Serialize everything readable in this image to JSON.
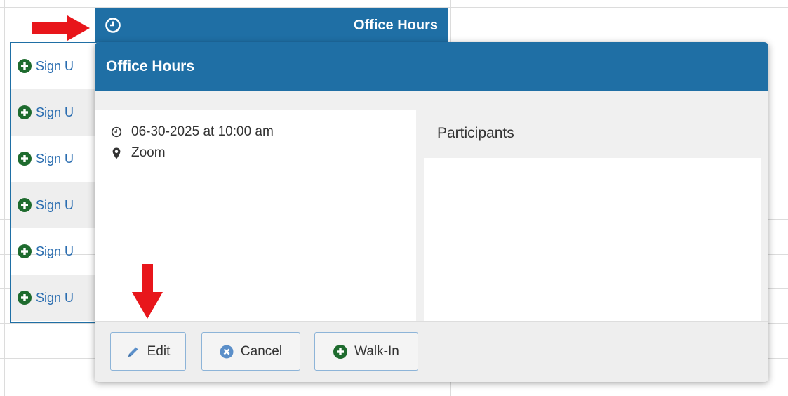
{
  "event": {
    "title": "Office Hours"
  },
  "slots": {
    "items": [
      {
        "label": "Sign U"
      },
      {
        "label": "Sign U"
      },
      {
        "label": "Sign U"
      },
      {
        "label": "Sign U"
      },
      {
        "label": "Sign U"
      },
      {
        "label": "Sign U"
      }
    ]
  },
  "popup": {
    "title": "Office Hours",
    "datetime": "06-30-2025 at 10:00 am",
    "location": "Zoom",
    "participants_label": "Participants",
    "buttons": {
      "edit": "Edit",
      "cancel": "Cancel",
      "walkin": "Walk-In"
    }
  },
  "colors": {
    "header_blue": "#1f6fa5",
    "plus_green": "#1e6b2e",
    "cancel_icon": "#5b8fc9",
    "arrow_red": "#e8161b"
  },
  "icons": {
    "event_bar": "clock-icon",
    "datetime": "clock-icon",
    "location": "map-marker-icon",
    "slot": "plus-circle-icon",
    "edit": "pencil-icon",
    "cancel": "times-circle-icon",
    "walkin": "plus-circle-icon"
  }
}
